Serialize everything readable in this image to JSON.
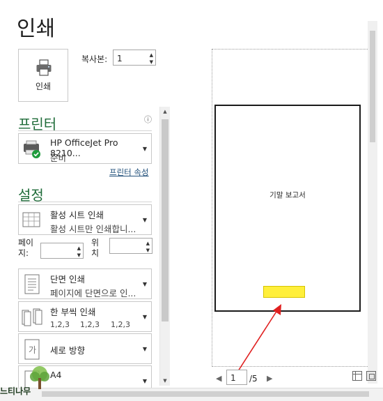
{
  "title": "인쇄",
  "print_button": {
    "label": "인쇄",
    "icon": "printer-icon"
  },
  "copies": {
    "label": "복사본:",
    "value": "1"
  },
  "printer": {
    "heading": "프린터",
    "info_icon": "ⓘ",
    "name": "HP OfficeJet Pro 8210...",
    "status": "준비",
    "properties_link": "프린터 속성"
  },
  "settings": {
    "heading": "설정",
    "what": {
      "title": "활성 시트 인쇄",
      "sub": "활성 시트만 인쇄합니..."
    },
    "pages_label": "페이지:",
    "to_label": "위치",
    "sides": {
      "title": "단면 인쇄",
      "sub": "페이지에 단면으로 인..."
    },
    "collate": {
      "title": "한 부씩 인쇄",
      "sub": [
        "1,2,3",
        "1,2,3",
        "1,2,3"
      ]
    },
    "orientation": {
      "title": "세로 방향"
    },
    "paper": {
      "title": "A4"
    }
  },
  "preview": {
    "page_title": "기말 보고서",
    "current_page": "1",
    "total_pages": "/5"
  },
  "watermark": "느티나무"
}
